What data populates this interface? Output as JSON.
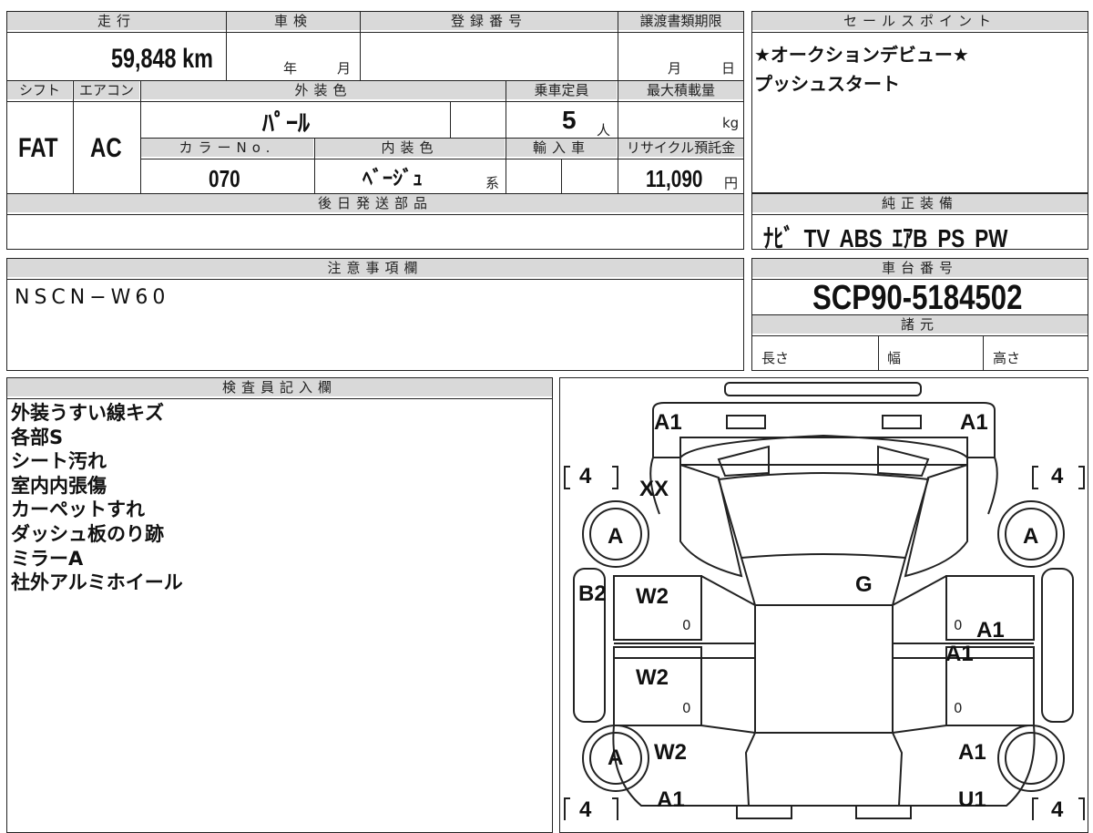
{
  "top_block": {
    "mileage_label": "走行",
    "mileage_value": "59,848 km",
    "inspection_label": "車検",
    "inspection_year": "年",
    "inspection_month": "月",
    "registration_label": "登録番号",
    "transfer_label": "譲渡書類期限",
    "transfer_month": "月",
    "transfer_day": "日",
    "shift_label": "シフト",
    "shift_value": "FAT",
    "aircon_label": "エアコン",
    "aircon_value": "AC",
    "exterior_color_label": "外装色",
    "exterior_color_value": "ﾊﾟｰﾙ",
    "capacity_label": "乗車定員",
    "capacity_value": "5",
    "capacity_unit": "人",
    "max_load_label": "最大積載量",
    "max_load_unit": "kg",
    "color_no_label": "カラーNo.",
    "color_no_value": "070",
    "interior_color_label": "内装色",
    "interior_color_value": "ﾍﾞｰｼﾞｭ",
    "interior_color_suffix": "系",
    "import_label": "輸入車",
    "recycle_label": "リサイクル預託金",
    "recycle_value": "11,090",
    "recycle_unit": "円",
    "later_parts_label": "後日発送部品"
  },
  "sales_points": {
    "label": "セールスポイント",
    "lines": [
      "★オークションデビュー★",
      "プッシュスタート"
    ]
  },
  "genuine_equipment": {
    "label": "純正装備",
    "value": "ﾅﾋﾞ TV ABS ｴｱB PS PW"
  },
  "notes": {
    "label": "注意事項欄",
    "value": "NSCN−W60"
  },
  "chassis": {
    "label": "車台番号",
    "value": "SCP90-5184502",
    "specs_label": "諸元",
    "length_label": "長さ",
    "width_label": "幅",
    "height_label": "高さ"
  },
  "inspector": {
    "label": "検査員記入欄",
    "lines": [
      "外装うすい線キズ",
      "各部S",
      "シート汚れ",
      "室内内張傷",
      "カーペットすれ",
      "ダッシュ板のり跡",
      "ミラーA",
      "社外アルミホイール"
    ]
  },
  "diagram": {
    "front_left_bumper": "A1",
    "front_right_bumper": "A1",
    "tire_fl": "4",
    "tire_fr": "4",
    "tire_rl": "4",
    "tire_rr": "4",
    "fender_fl": "XX",
    "wheel_fl": "A",
    "wheel_fr": "A",
    "wheel_rl": "A",
    "sill_left": "B2",
    "door_fl": "W2",
    "door_rl": "W2",
    "quarter_rl": "W2",
    "windshield": "G",
    "door_fr": "A1",
    "door_fr_2": "A1",
    "quarter_rr": "A1",
    "rear_left": "A1",
    "rear_right": "U1",
    "zero": "0"
  }
}
